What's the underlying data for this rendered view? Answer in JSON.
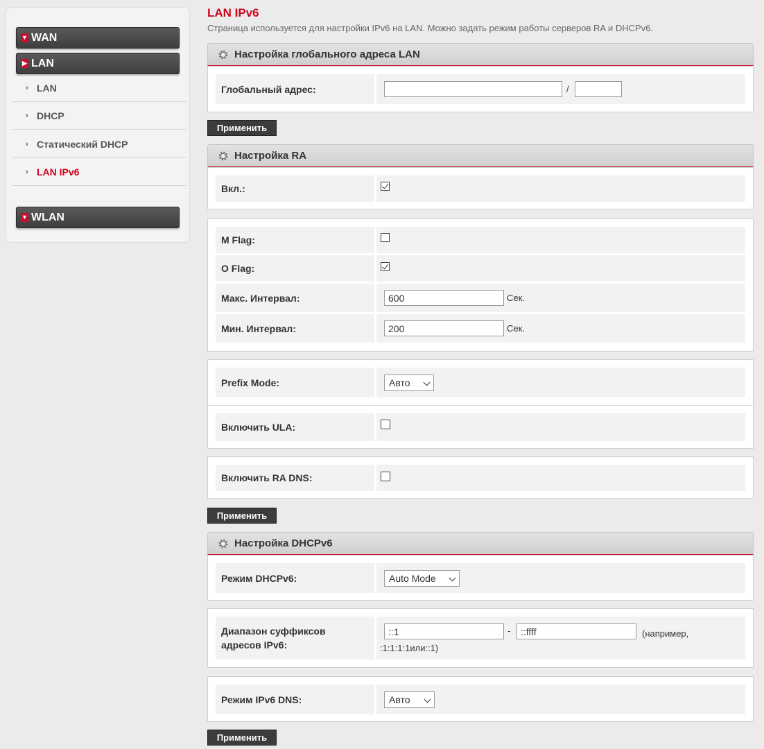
{
  "sidebar": {
    "wan": "WAN",
    "lan": "LAN",
    "items": [
      "LAN",
      "DHCP",
      "Статический DHCP",
      "LAN IPv6"
    ],
    "bullet": "›",
    "wlan": "WLAN",
    "expand_arrow": "chevron-down-icon",
    "active_arrow": "chevron-right-icon"
  },
  "page": {
    "title": "LAN IPv6",
    "description": "Страница используется для настройки IPv6 на LAN. Можно задать режим работы серверов RA и DHCPv6."
  },
  "global": {
    "header": "Настройка глобального адреса LAN",
    "address_label": "Глобальный адрес:",
    "address_value": "",
    "slash": "/",
    "prefix_value": ""
  },
  "apply_label": "Применить",
  "ra": {
    "header": "Настройка RA",
    "enabled_label": "Вкл.:",
    "enabled": true,
    "mflag_label": "M Flag:",
    "mflag": false,
    "oflag_label": "O Flag:",
    "oflag": true,
    "max_label": "Макс. Интервал:",
    "max_value": "600",
    "min_label": "Мин. Интервал:",
    "min_value": "200",
    "unit": "Сек.",
    "prefix_mode_label": "Prefix Mode:",
    "prefix_mode_value": "Авто",
    "ula_label": "Включить ULA:",
    "ula": false,
    "radns_label": "Включить RA DNS:",
    "radns": false
  },
  "dhcp": {
    "header": "Настройка DHCPv6",
    "mode_label": "Режим DHCPv6:",
    "mode_value": "Auto Mode",
    "range_label": "Диапазон суффиксов адресов IPv6:",
    "range_start": "::1",
    "dash": "-",
    "range_end": "::ffff",
    "range_hint": "(например, :1:1:1:1или::1)",
    "dns_label": "Режим IPv6 DNS:",
    "dns_value": "Авто"
  },
  "colors": {
    "accent": "#d0021b",
    "button": "#3c3c3c"
  }
}
